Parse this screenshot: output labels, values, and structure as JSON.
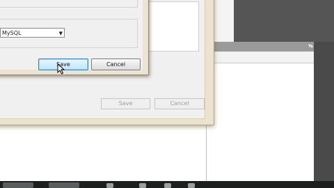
{
  "dialog": {
    "db_type_select": {
      "value": "MySQL"
    },
    "save_label": "Save",
    "cancel_label": "Cancel"
  },
  "parent_window": {
    "save_label": "Save",
    "cancel_label": "Cancel"
  },
  "background_window": {
    "controls_label": "▾▴"
  },
  "icons": [
    "dropdown-arrow-icon",
    "mouse-pointer-icon"
  ]
}
